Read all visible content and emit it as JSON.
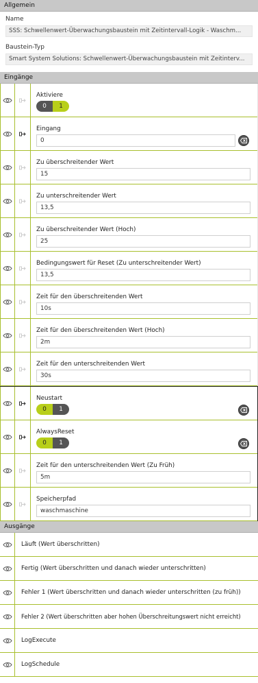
{
  "general": {
    "header": "Allgemein",
    "name_label": "Name",
    "name_value": "SSS: Schwellenwert-Überwachungsbaustein mit Zeitintervall-Logik - Waschm...",
    "type_label": "Baustein-Typ",
    "type_value": "Smart System Solutions: Schwellenwert-Überwachungsbaustein mit Zeitinterv..."
  },
  "inputs": {
    "header": "Eingänge",
    "aktiviere": {
      "label": "Aktiviere",
      "off": "0",
      "on": "1",
      "value": "1"
    },
    "eingang": {
      "label": "Eingang",
      "value": "0"
    },
    "zu_ueber": {
      "label": "Zu überschreitender Wert",
      "value": "15"
    },
    "zu_unter": {
      "label": "Zu unterschreitender Wert",
      "value": "13,5"
    },
    "zu_ueber_hoch": {
      "label": "Zu überschreitender Wert (Hoch)",
      "value": "25"
    },
    "reset": {
      "label": "Bedingungswert für Reset (Zu unterschreitender Wert)",
      "value": "13,5"
    },
    "zeit_ueber": {
      "label": "Zeit für den überschreitenden Wert",
      "value": "10s"
    },
    "zeit_ueber_hoch": {
      "label": "Zeit für den überschreitenden Wert (Hoch)",
      "value": "2m"
    },
    "zeit_unter": {
      "label": "Zeit für den unterschreitenden Wert",
      "value": "30s"
    },
    "neustart": {
      "label": "Neustart",
      "off": "0",
      "on": "1",
      "value": "0"
    },
    "always_reset": {
      "label": "AlwaysReset",
      "off": "0",
      "on": "1",
      "value": "0"
    },
    "zeit_unter_frueh": {
      "label": "Zeit für den unterschreitenden Wert (Zu Früh)",
      "value": "5m"
    },
    "speicherpfad": {
      "label": "Speicherpfad",
      "value": "waschmaschine"
    }
  },
  "outputs": {
    "header": "Ausgänge",
    "items": [
      "Läuft (Wert überschritten)",
      "Fertig (Wert überschritten und danach wieder unterschritten)",
      "Fehler 1 (Wert überschritten und danach wieder unterschritten (zu früh))",
      "Fehler 2 (Wert überschritten aber hohen Überschreitungswert nicht erreicht)",
      "LogExecute",
      "LogSchedule"
    ]
  },
  "colors": {
    "accent": "#b8cf1a",
    "border": "#a8bf2c",
    "toggle_dark": "#555555",
    "header_bg": "#c8c8c8"
  },
  "icons": {
    "eye": "eye-icon",
    "port_connected": "port-connected-icon",
    "port_empty": "port-empty-icon",
    "clear": "clear-icon"
  }
}
